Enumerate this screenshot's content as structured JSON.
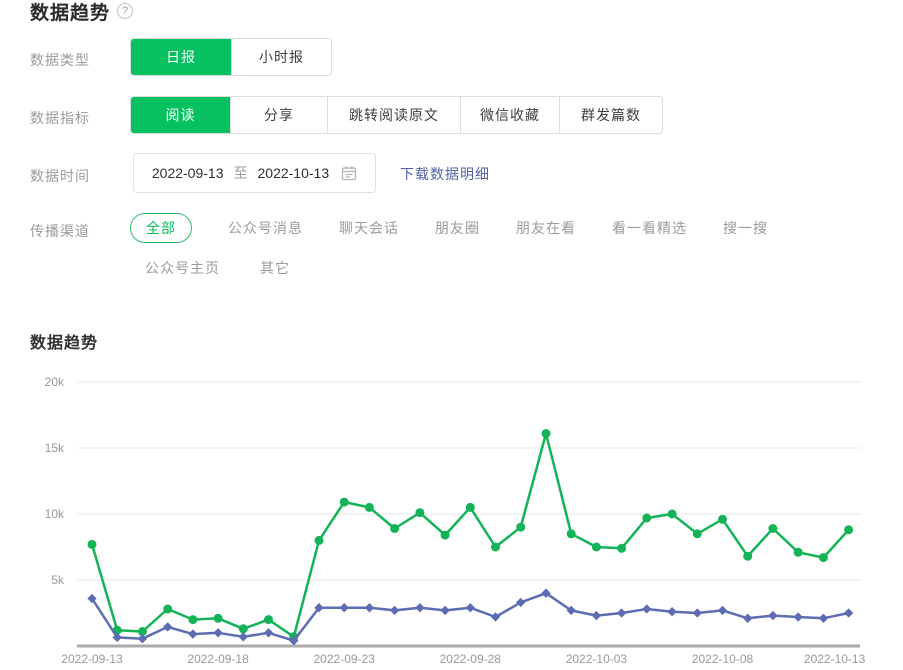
{
  "page": {
    "title": "数据趋势",
    "help_icon": "?"
  },
  "filters": {
    "type": {
      "label": "数据类型",
      "options": [
        {
          "label": "日报",
          "selected": true
        },
        {
          "label": "小时报",
          "selected": false
        }
      ]
    },
    "metric": {
      "label": "数据指标",
      "options": [
        {
          "label": "阅读",
          "selected": true
        },
        {
          "label": "分享",
          "selected": false
        },
        {
          "label": "跳转阅读原文",
          "selected": false
        },
        {
          "label": "微信收藏",
          "selected": false
        },
        {
          "label": "群发篇数",
          "selected": false
        }
      ]
    },
    "time": {
      "label": "数据时间",
      "start": "2022-09-13",
      "separator": "至",
      "end": "2022-10-13",
      "download_link": "下载数据明细"
    },
    "channel": {
      "label": "传播渠道",
      "row1": [
        {
          "label": "全部",
          "selected": true
        },
        {
          "label": "公众号消息",
          "selected": false
        },
        {
          "label": "聊天会话",
          "selected": false
        },
        {
          "label": "朋友圈",
          "selected": false
        },
        {
          "label": "朋友在看",
          "selected": false
        },
        {
          "label": "看一看精选",
          "selected": false
        },
        {
          "label": "搜一搜",
          "selected": false
        }
      ],
      "row2": [
        {
          "label": "公众号主页",
          "selected": false
        },
        {
          "label": "其它",
          "selected": false
        }
      ]
    }
  },
  "chart_section": {
    "title": "数据趋势"
  },
  "colors": {
    "accent_green": "#07C160",
    "line_green": "#15b358",
    "line_blue": "#5d6cb3",
    "link_blue": "#5661a8",
    "axis_text": "#999999",
    "gridline": "#e9e9e9",
    "axis_line": "#aaaaaa"
  },
  "chart_data": {
    "type": "line",
    "title": "数据趋势",
    "xlabel": "",
    "ylabel": "",
    "ylim": [
      0,
      20000
    ],
    "grid": "horizontal-only",
    "legend": "none",
    "x": [
      "2022-09-13",
      "2022-09-14",
      "2022-09-15",
      "2022-09-16",
      "2022-09-17",
      "2022-09-18",
      "2022-09-19",
      "2022-09-20",
      "2022-09-21",
      "2022-09-22",
      "2022-09-23",
      "2022-09-24",
      "2022-09-25",
      "2022-09-26",
      "2022-09-27",
      "2022-09-28",
      "2022-09-29",
      "2022-09-30",
      "2022-10-01",
      "2022-10-02",
      "2022-10-03",
      "2022-10-04",
      "2022-10-05",
      "2022-10-06",
      "2022-10-07",
      "2022-10-08",
      "2022-10-09",
      "2022-10-10",
      "2022-10-11",
      "2022-10-12",
      "2022-10-13"
    ],
    "xtick_indices": [
      0,
      5,
      10,
      15,
      20,
      25,
      30
    ],
    "yticks": [
      {
        "value": 20000,
        "label": "20k"
      },
      {
        "value": 15000,
        "label": "15k"
      },
      {
        "value": 10000,
        "label": "10k"
      },
      {
        "value": 5000,
        "label": "5k"
      }
    ],
    "series": [
      {
        "name": "green-series",
        "color": "#15b358",
        "marker": "circle",
        "values": [
          7700,
          1200,
          1100,
          2800,
          2000,
          2100,
          1300,
          2000,
          700,
          8000,
          10900,
          10500,
          8900,
          10100,
          8400,
          10500,
          7500,
          9000,
          16100,
          8500,
          7500,
          7400,
          9700,
          10000,
          8500,
          9600,
          6800,
          8900,
          7100,
          6700,
          8800
        ]
      },
      {
        "name": "blue-series",
        "color": "#5d6cb3",
        "marker": "diamond",
        "values": [
          3600,
          650,
          550,
          1450,
          900,
          1000,
          700,
          1000,
          400,
          2900,
          2900,
          2900,
          2700,
          2900,
          2700,
          2900,
          2200,
          3300,
          4000,
          2700,
          2300,
          2500,
          2800,
          2600,
          2500,
          2700,
          2100,
          2300,
          2200,
          2100,
          2500
        ]
      }
    ]
  }
}
